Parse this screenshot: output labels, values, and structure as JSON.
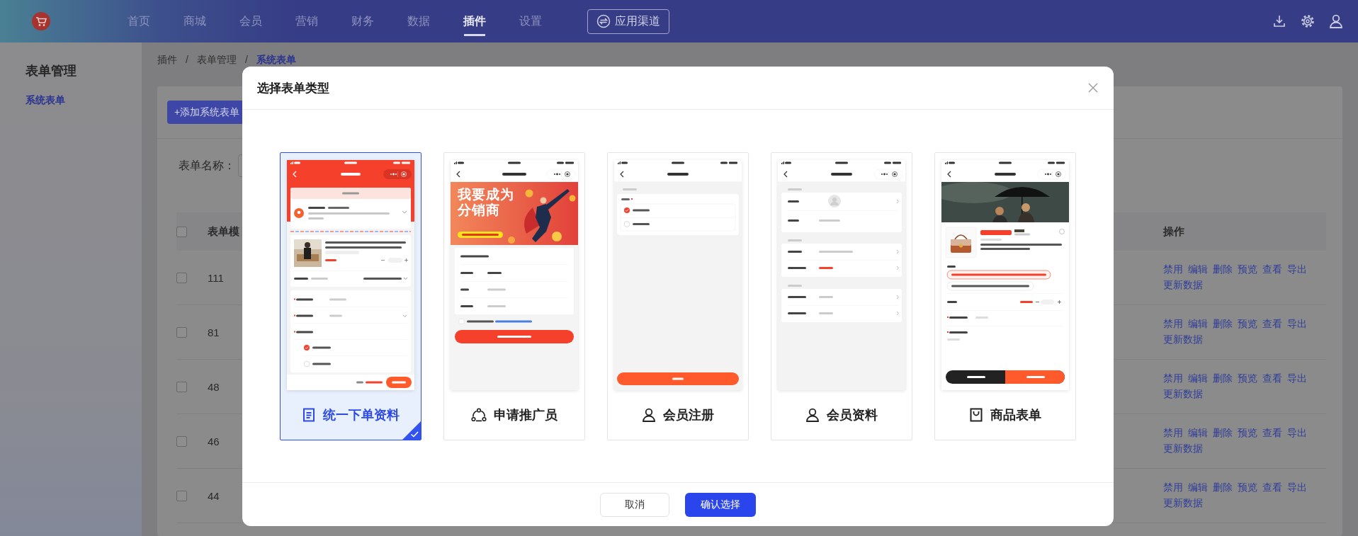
{
  "nav": {
    "items": [
      {
        "label": "首页",
        "selected": false
      },
      {
        "label": "商城",
        "selected": false
      },
      {
        "label": "会员",
        "selected": false
      },
      {
        "label": "营销",
        "selected": false
      },
      {
        "label": "财务",
        "selected": false
      },
      {
        "label": "数据",
        "selected": false
      },
      {
        "label": "插件",
        "selected": true
      },
      {
        "label": "设置",
        "selected": false
      }
    ],
    "channel_button": "应用渠道"
  },
  "sidebar": {
    "title": "表单管理",
    "items": [
      {
        "label": "系统表单",
        "selected": true
      }
    ]
  },
  "breadcrumb": {
    "separator": "/",
    "items": [
      {
        "label": "插件",
        "selected": false
      },
      {
        "label": "表单管理",
        "selected": false
      },
      {
        "label": "系统表单",
        "selected": true
      }
    ]
  },
  "toolbar": {
    "add_button": "+添加系统表单"
  },
  "filter": {
    "label": "表单名称："
  },
  "table": {
    "header_checked": false,
    "columns": [
      {
        "kind": "name",
        "label": "表单模"
      },
      {
        "kind": "actions",
        "label": "操作"
      }
    ],
    "rows": [
      {
        "checked": false,
        "cells": [
          "111"
        ],
        "actions": [
          "禁用",
          "编辑",
          "删除",
          "预览",
          "查看",
          "导出",
          "更新数据"
        ]
      },
      {
        "checked": false,
        "cells": [
          "81"
        ],
        "actions": [
          "禁用",
          "编辑",
          "删除",
          "预览",
          "查看",
          "导出",
          "更新数据"
        ]
      },
      {
        "checked": false,
        "cells": [
          "48"
        ],
        "actions": [
          "禁用",
          "编辑",
          "删除",
          "预览",
          "查看",
          "导出",
          "更新数据"
        ]
      },
      {
        "checked": false,
        "cells": [
          "46"
        ],
        "actions": [
          "禁用",
          "编辑",
          "删除",
          "预览",
          "查看",
          "导出",
          "更新数据"
        ]
      },
      {
        "checked": false,
        "cells": [
          "44"
        ],
        "actions": [
          "禁用",
          "编辑",
          "删除",
          "预览",
          "查看",
          "导出",
          "更新数据"
        ]
      }
    ]
  },
  "modal": {
    "title": "选择表单类型",
    "previews": [
      {
        "kind": "order",
        "label": "统一下单资料",
        "selected": true
      },
      {
        "kind": "promoter",
        "label": "申请推广员",
        "selected": false,
        "banner": {
          "headline": [
            "我要成为",
            "分销商"
          ]
        }
      },
      {
        "kind": "register",
        "label": "会员注册",
        "selected": false
      },
      {
        "kind": "profile",
        "label": "会员资料",
        "selected": false
      },
      {
        "kind": "product",
        "label": "商品表单",
        "selected": false
      }
    ],
    "buttons": [
      {
        "kind": "secondary",
        "label": "取消"
      },
      {
        "kind": "primary",
        "label": "确认选择"
      }
    ]
  }
}
